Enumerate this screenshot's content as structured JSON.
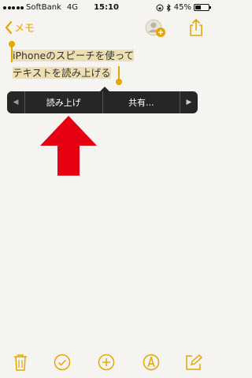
{
  "status_bar": {
    "carrier": "SoftBank",
    "network": "4G",
    "time": "15:10",
    "battery": "45%",
    "battery_level": 0.45
  },
  "nav": {
    "back_label": "メモ"
  },
  "note": {
    "line1": "iPhoneのスピーチを使って",
    "line2": "テキストを読み上げる"
  },
  "context_menu": {
    "items": [
      "読み上げ",
      "共有..."
    ],
    "prev_icon": "arrow-left-icon",
    "next_icon": "arrow-right-icon"
  },
  "toolbar": {
    "icons": [
      "trash-icon",
      "checklist-icon",
      "add-icon",
      "draw-icon",
      "compose-icon"
    ]
  },
  "colors": {
    "accent": "#e5a600",
    "arrow": "#e60012",
    "menu_bg": "#262626",
    "highlight": "#e8cd7d"
  }
}
